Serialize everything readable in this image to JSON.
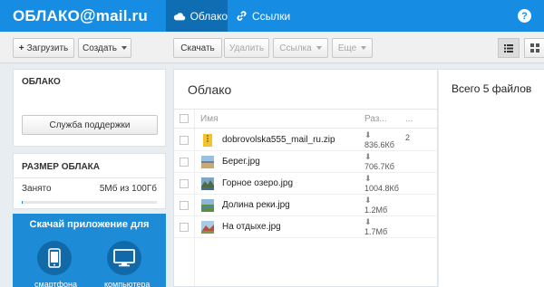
{
  "header": {
    "logo_left": "ОБЛАКО",
    "logo_at": "@",
    "logo_right": "mail.ru",
    "tabs": [
      {
        "label": "Облако",
        "icon": "cloud-icon",
        "active": true
      },
      {
        "label": "Ссылки",
        "icon": "link-icon",
        "active": false
      }
    ],
    "help_label": "Помощь"
  },
  "toolbar": {
    "upload_label": "Загрузить",
    "create_label": "Создать",
    "download_label": "Скачать",
    "delete_label": "Удалить",
    "link_label": "Ссылка",
    "more_label": "Еще"
  },
  "sidebar": {
    "cloud_title": "ОБЛАКО",
    "support_label": "Служба поддержки",
    "size_title": "РАЗМЕР ОБЛАКА",
    "used_label": "Занято",
    "used_value": "5Мб из 100Гб",
    "used_fraction": 5e-05,
    "promo_title": "Скачай приложение для",
    "promo_phone": "смартфона",
    "promo_computer": "компьютера"
  },
  "main": {
    "title": "Облако",
    "columns": {
      "name": "Имя",
      "size": "Раз...",
      "more": "..."
    },
    "files": [
      {
        "name": "dobrovolska555_mail_ru.zip",
        "size": "836.6Кб",
        "extra": "2",
        "type": "zip"
      },
      {
        "name": "Берег.jpg",
        "size": "706.7Кб",
        "extra": "",
        "type": "image-shore"
      },
      {
        "name": "Горное озеро.jpg",
        "size": "1004.8Кб",
        "extra": "",
        "type": "image-lake"
      },
      {
        "name": "Долина реки.jpg",
        "size": "1.2Мб",
        "extra": "",
        "type": "image-valley"
      },
      {
        "name": "На отдыхе.jpg",
        "size": "1.7Мб",
        "extra": "",
        "type": "image-rest"
      }
    ]
  },
  "info": {
    "total_label": "Всего 5 файлов"
  },
  "colors": {
    "brand": "#168de2",
    "brand_dark": "#0f6db3"
  }
}
